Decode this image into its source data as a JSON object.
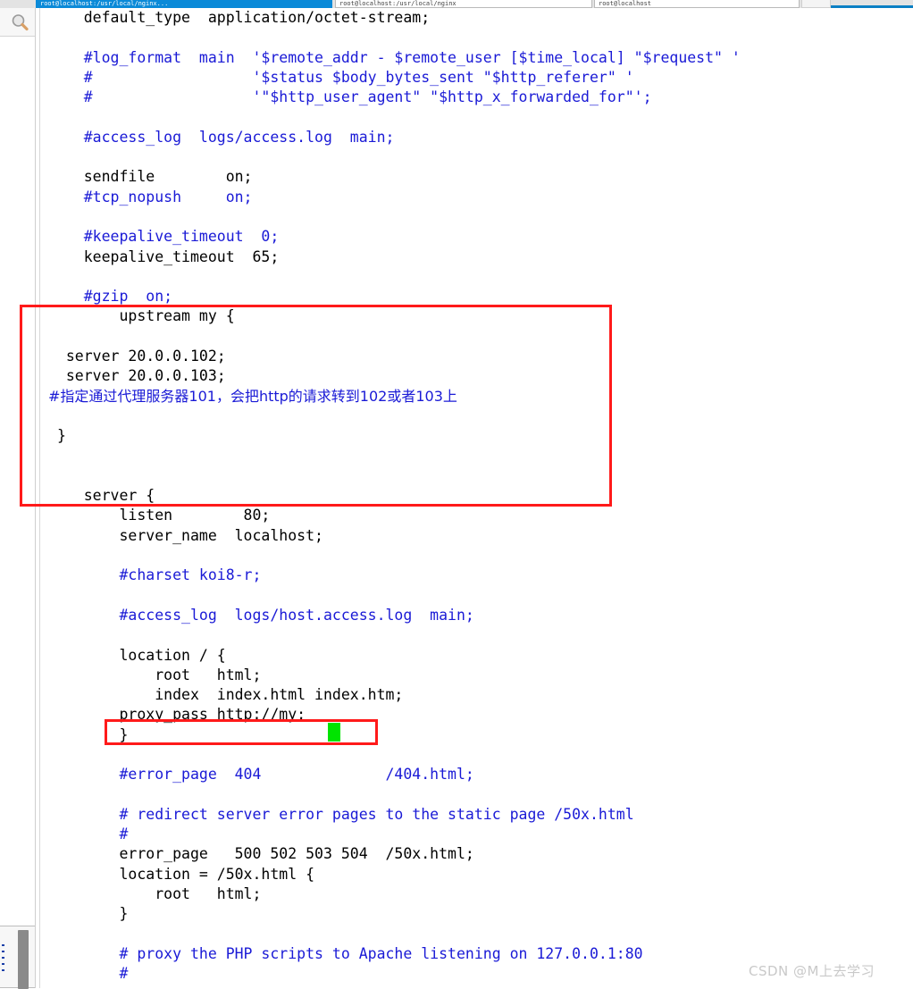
{
  "window": {
    "tabs": [
      {
        "label": "root@localhost:/usr/local/nginx...",
        "active": true
      },
      {
        "label": "root@localhost:/usr/local/nginx",
        "active": false
      },
      {
        "label": "root@localhost",
        "active": false
      },
      {
        "label": "",
        "active": false
      }
    ]
  },
  "sidebar": {
    "search_icon": "search-icon",
    "vertical_tab_label": ""
  },
  "editor": {
    "language": "nginx-conf",
    "filename": "nginx.conf",
    "lines": [
      {
        "indent": 4,
        "text": "default_type  application/octet-stream;",
        "color": "black"
      },
      {
        "indent": 0,
        "text": "",
        "color": "black"
      },
      {
        "indent": 4,
        "text": "#log_format  main  '$remote_addr - $remote_user [$time_local] \"$request\" '",
        "color": "blue"
      },
      {
        "indent": 4,
        "text": "#                  '$status $body_bytes_sent \"$http_referer\" '",
        "color": "blue"
      },
      {
        "indent": 4,
        "text": "#                  '\"$http_user_agent\" \"$http_x_forwarded_for\"';",
        "color": "blue"
      },
      {
        "indent": 0,
        "text": "",
        "color": "black"
      },
      {
        "indent": 4,
        "text": "#access_log  logs/access.log  main;",
        "color": "blue"
      },
      {
        "indent": 0,
        "text": "",
        "color": "black"
      },
      {
        "indent": 4,
        "text": "sendfile        on;",
        "color": "black"
      },
      {
        "indent": 4,
        "text": "#tcp_nopush     on;",
        "color": "blue"
      },
      {
        "indent": 0,
        "text": "",
        "color": "black"
      },
      {
        "indent": 4,
        "text": "#keepalive_timeout  0;",
        "color": "blue"
      },
      {
        "indent": 4,
        "text": "keepalive_timeout  65;",
        "color": "black"
      },
      {
        "indent": 0,
        "text": "",
        "color": "black"
      },
      {
        "indent": 4,
        "text": "#gzip  on;",
        "color": "blue"
      },
      {
        "indent": 8,
        "text": "upstream my {",
        "color": "black"
      },
      {
        "indent": 0,
        "text": "",
        "color": "black"
      },
      {
        "indent": 2,
        "text": "server 20.0.0.102;",
        "color": "black"
      },
      {
        "indent": 2,
        "text": "server 20.0.0.103;",
        "color": "black"
      },
      {
        "indent": 0,
        "text": "#指定通过代理服务器101，会把http的请求转到102或者103上",
        "color": "blue",
        "cjk": true
      },
      {
        "indent": 0,
        "text": "",
        "color": "black"
      },
      {
        "indent": 1,
        "text": "}",
        "color": "black"
      },
      {
        "indent": 0,
        "text": "",
        "color": "black"
      },
      {
        "indent": 0,
        "text": "",
        "color": "black"
      },
      {
        "indent": 4,
        "text": "server {",
        "color": "black"
      },
      {
        "indent": 8,
        "text": "listen        80;",
        "color": "black"
      },
      {
        "indent": 8,
        "text": "server_name  localhost;",
        "color": "black"
      },
      {
        "indent": 0,
        "text": "",
        "color": "black"
      },
      {
        "indent": 8,
        "text": "#charset koi8-r;",
        "color": "blue"
      },
      {
        "indent": 0,
        "text": "",
        "color": "black"
      },
      {
        "indent": 8,
        "text": "#access_log  logs/host.access.log  main;",
        "color": "blue"
      },
      {
        "indent": 0,
        "text": "",
        "color": "black"
      },
      {
        "indent": 8,
        "text": "location / {",
        "color": "black"
      },
      {
        "indent": 12,
        "text": "root   html;",
        "color": "black"
      },
      {
        "indent": 12,
        "text": "index  index.html index.htm;",
        "color": "black"
      },
      {
        "indent": 8,
        "text": "proxy_pass http://my;",
        "color": "black"
      },
      {
        "indent": 8,
        "text": "}",
        "color": "black"
      },
      {
        "indent": 0,
        "text": "",
        "color": "black"
      },
      {
        "indent": 8,
        "text": "#error_page  404              /404.html;",
        "color": "blue"
      },
      {
        "indent": 0,
        "text": "",
        "color": "black"
      },
      {
        "indent": 8,
        "text": "# redirect server error pages to the static page /50x.html",
        "color": "blue"
      },
      {
        "indent": 8,
        "text": "#",
        "color": "blue"
      },
      {
        "indent": 8,
        "text": "error_page   500 502 503 504  /50x.html;",
        "color": "black"
      },
      {
        "indent": 8,
        "text": "location = /50x.html {",
        "color": "black"
      },
      {
        "indent": 12,
        "text": "root   html;",
        "color": "black"
      },
      {
        "indent": 8,
        "text": "}",
        "color": "black"
      },
      {
        "indent": 0,
        "text": "",
        "color": "black"
      },
      {
        "indent": 8,
        "text": "# proxy the PHP scripts to Apache listening on 127.0.0.1:80",
        "color": "blue"
      },
      {
        "indent": 8,
        "text": "#",
        "color": "blue"
      }
    ],
    "cursor": {
      "visible": true,
      "color": "#00e400",
      "after_text": "proxy_pass http://my;"
    }
  },
  "annotations": {
    "boxes": [
      {
        "name": "upstream-block-highlight",
        "color": "#ff1a1a"
      },
      {
        "name": "proxy-pass-highlight",
        "color": "#ff1a1a"
      }
    ]
  },
  "watermark": {
    "text": "CSDN @M上去学习"
  },
  "colors": {
    "comment_blue": "#1a1ad6",
    "code_black": "#000000",
    "highlight_red": "#ff1a1a",
    "cursor_green": "#00e400",
    "active_tab_blue": "#0b8ad8",
    "watermark_gray": "#c9c9c9"
  }
}
